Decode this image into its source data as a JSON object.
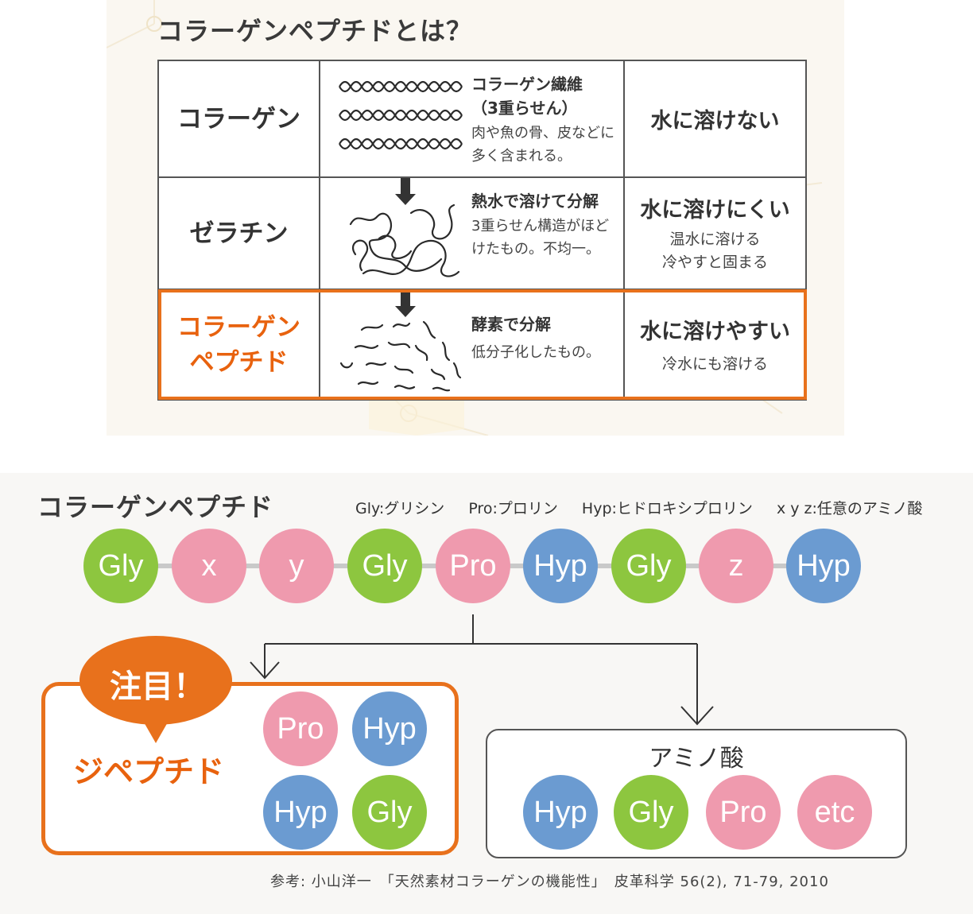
{
  "top": {
    "title": "コラーゲンペプチドとは？",
    "rows": [
      {
        "name": "コラーゲン",
        "desc_head_1": "コラーゲン繊維",
        "desc_head_2": "（3重らせん）",
        "desc_body": "肉や魚の骨、皮などに多く含まれる。",
        "solubility": "水に溶けない",
        "solubility_note_1": "",
        "solubility_note_2": ""
      },
      {
        "name": "ゼラチン",
        "desc_head_1": "熱水で溶けて分解",
        "desc_head_2": "",
        "desc_body": "3重らせん構造がほどけたもの。不均一。",
        "solubility": "水に溶けにくい",
        "solubility_note_1": "温水に溶ける",
        "solubility_note_2": "冷やすと固まる"
      },
      {
        "name_line1": "コラーゲン",
        "name_line2": "ペプチド",
        "desc_head_1": "酵素で分解",
        "desc_head_2": "",
        "desc_body": "低分子化したもの。",
        "solubility": "水に溶けやすい",
        "solubility_note_1": "冷水にも溶ける",
        "solubility_note_2": ""
      }
    ]
  },
  "bottom": {
    "title": "コラーゲンペプチド",
    "legend": [
      "Gly:グリシン",
      "Pro:プロリン",
      "Hyp:ヒドロキシプロリン",
      "x y z:任意のアミノ酸"
    ],
    "chain": [
      {
        "label": "Gly",
        "color": "#8dc63f"
      },
      {
        "label": "x",
        "color": "#ef9aae"
      },
      {
        "label": "y",
        "color": "#ef9aae"
      },
      {
        "label": "Gly",
        "color": "#8dc63f"
      },
      {
        "label": "Pro",
        "color": "#ef9aae"
      },
      {
        "label": "Hyp",
        "color": "#6b9bd1"
      },
      {
        "label": "Gly",
        "color": "#8dc63f"
      },
      {
        "label": "z",
        "color": "#ef9aae"
      },
      {
        "label": "Hyp",
        "color": "#6b9bd1"
      }
    ],
    "attention": "注目！",
    "dipeptide_label": "ジペプチド",
    "dipeptides": [
      [
        "Pro",
        "Hyp"
      ],
      [
        "Hyp",
        "Gly"
      ]
    ],
    "amino_title": "アミノ酸",
    "amino_acids": [
      "Hyp",
      "Gly",
      "Pro",
      "etc"
    ],
    "reference": "参考: 小山洋一　「天然素材コラーゲンの機能性」　皮革科学 56(2), 71-79, 2010"
  },
  "colors": {
    "orange": "#e8711c",
    "gly_green": "#8dc63f",
    "pro_pink": "#ef9aae",
    "hyp_blue": "#6b9bd1"
  }
}
